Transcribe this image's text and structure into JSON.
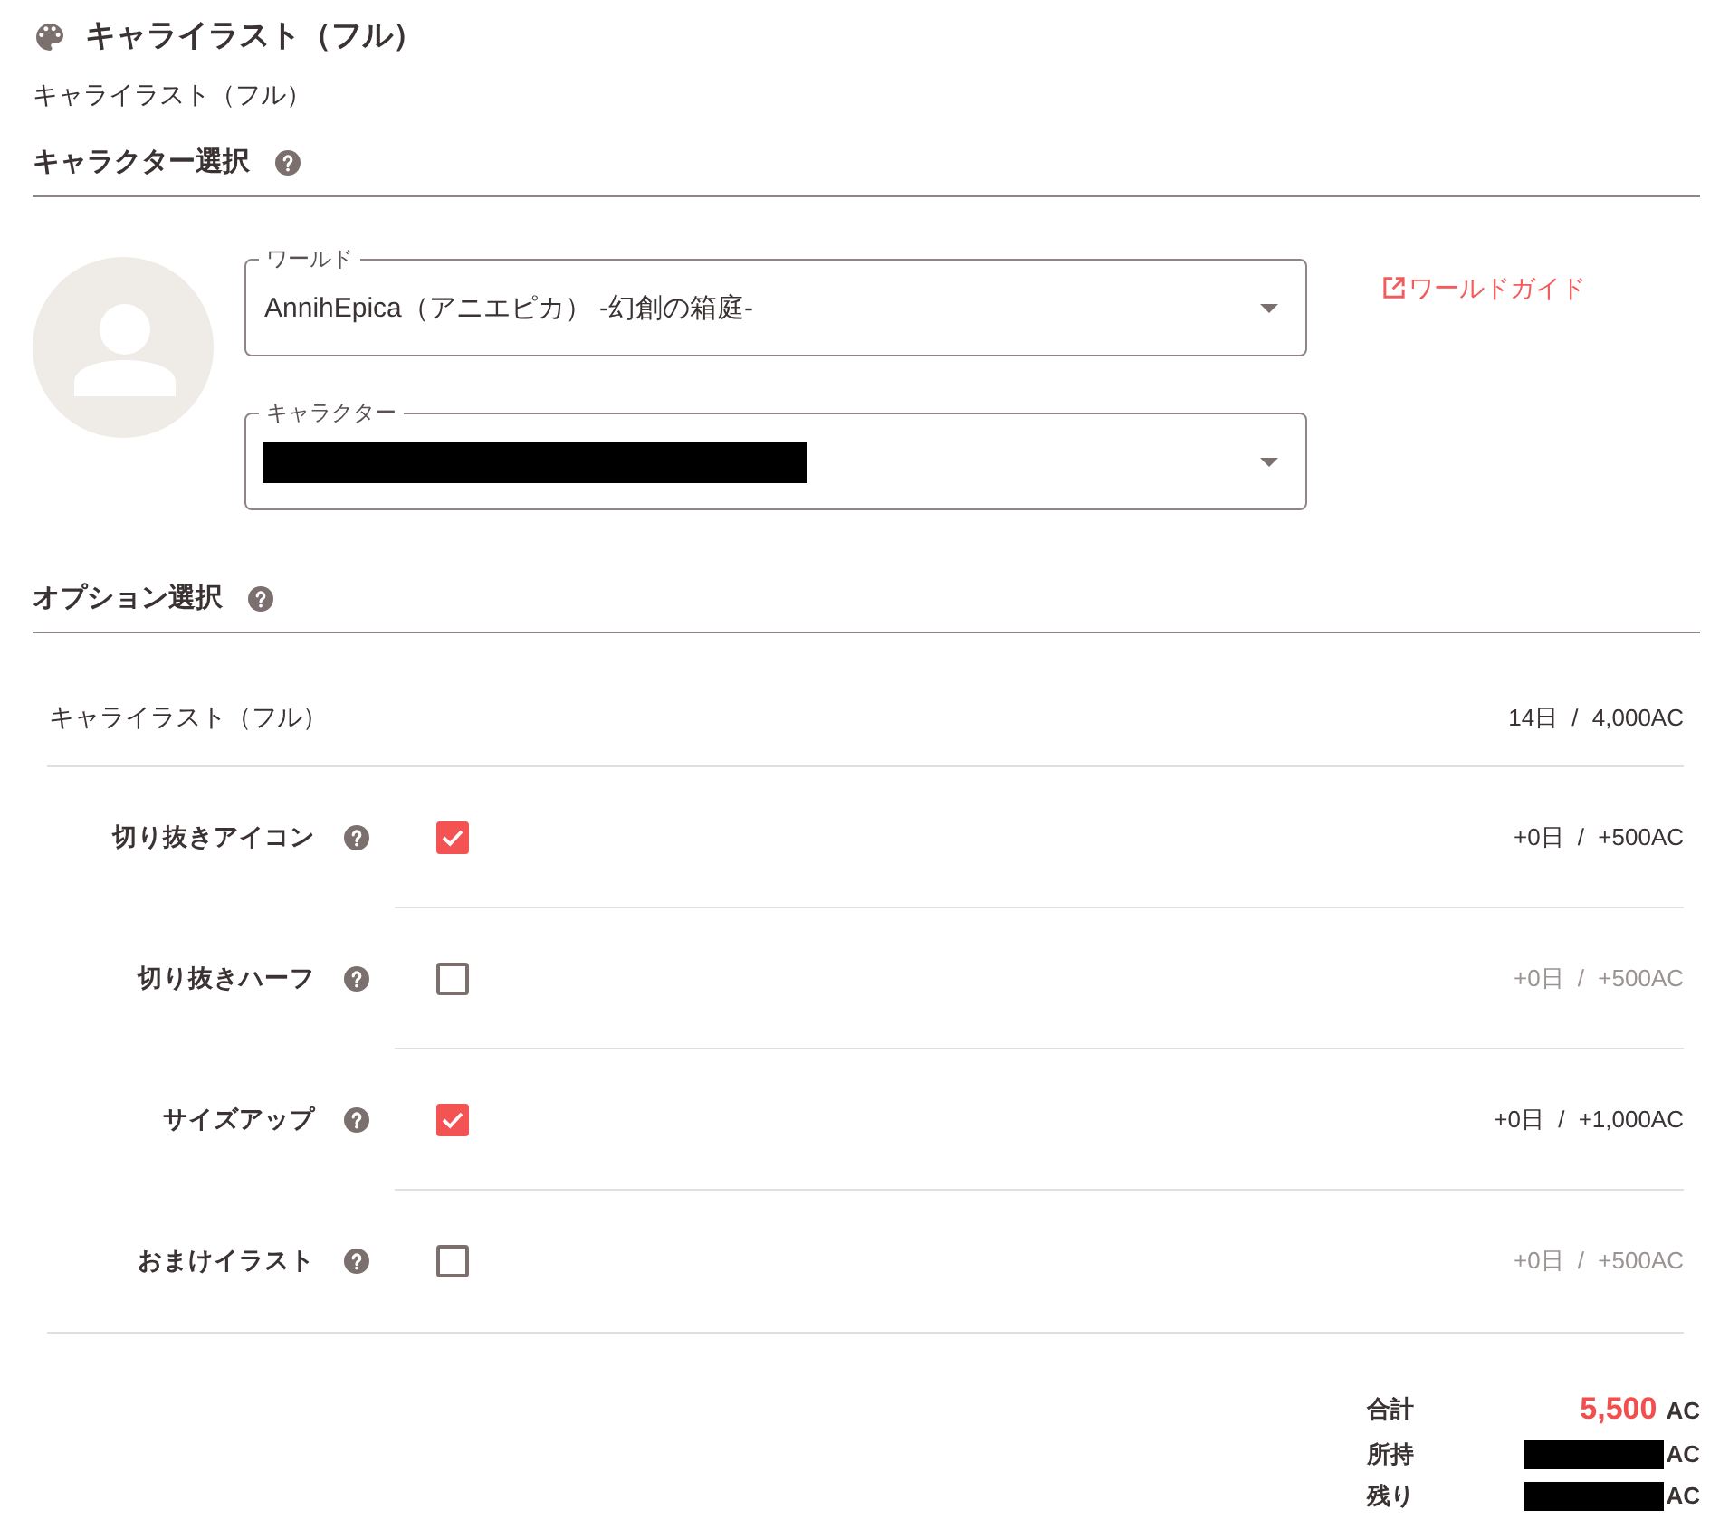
{
  "header": {
    "title": "キャライラスト（フル）",
    "subtitle": "キャライラスト（フル）"
  },
  "character_section": {
    "heading": "キャラクター選択",
    "world_field": {
      "label": "ワールド",
      "value": "AnnihEpica（アニエピカ） -幻創の箱庭-"
    },
    "character_field": {
      "label": "キャラクター",
      "redacted": true
    },
    "world_guide_link": "ワールドガイド"
  },
  "options_section": {
    "heading": "オプション選択",
    "base_item": {
      "label": "キャライラスト（フル）",
      "price": "14日 / 4,000AC"
    },
    "options": [
      {
        "label": "切り抜きアイコン",
        "checked": true,
        "price": "+0日 / +500AC"
      },
      {
        "label": "切り抜きハーフ",
        "checked": false,
        "price": "+0日 / +500AC"
      },
      {
        "label": "サイズアップ",
        "checked": true,
        "price": "+0日 / +1,000AC"
      },
      {
        "label": "おまけイラスト",
        "checked": false,
        "price": "+0日 / +500AC"
      }
    ]
  },
  "totals": [
    {
      "kind": "total",
      "label": "合計",
      "amount": "5,500",
      "unit": "AC",
      "redacted": false
    },
    {
      "kind": "balance",
      "label": "所持",
      "unit": "AC",
      "redacted": true
    },
    {
      "kind": "balance",
      "label": "残り",
      "unit": "AC",
      "redacted": true
    }
  ]
}
